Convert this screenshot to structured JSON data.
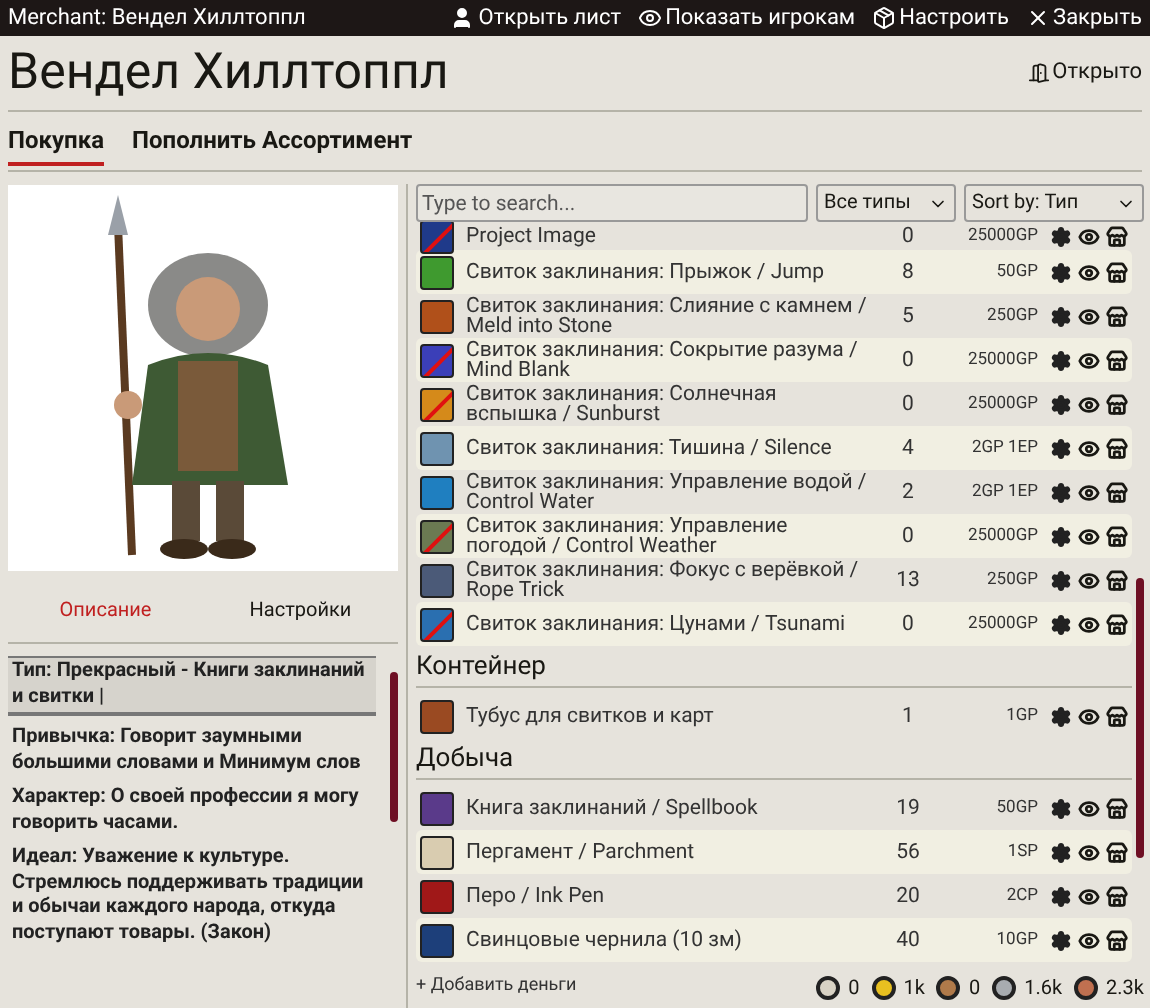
{
  "window": {
    "title": "Merchant: Вендел Хиллтоппл",
    "actions": [
      {
        "kind": "user",
        "label": "Открыть лист"
      },
      {
        "kind": "eye",
        "label": "Показать игрокам"
      },
      {
        "kind": "box",
        "label": "Настроить"
      },
      {
        "kind": "close",
        "label": "Закрыть"
      }
    ]
  },
  "merchant": {
    "name": "Вендел Хиллтоппл",
    "status": "Открыто"
  },
  "tabs": [
    {
      "label": "Покупка",
      "selected": true
    },
    {
      "label": "Пополнить Ассортимент",
      "selected": false
    }
  ],
  "side_tabs": [
    {
      "label": "Описание",
      "selected": true
    },
    {
      "label": "Настройки",
      "selected": false
    }
  ],
  "description": [
    {
      "text": "Тип: Прекрасный - Книги заклинаний и свитки |",
      "boxed": true
    },
    {
      "text": "Привычка: Говорит заумными большими словами и Минимум слов",
      "boxed": false
    },
    {
      "text": "Характер: О своей профессии я могу говорить часами.",
      "boxed": false
    },
    {
      "text": "Идеал: Уважение к культуре. Стремлюсь поддерживать традиции и обычаи каждого народа, откуда поступают товары. (Закон)",
      "boxed": false
    }
  ],
  "search": {
    "placeholder": "Type to search..."
  },
  "type_filter": "Все типы",
  "sort": "Sort by: Тип",
  "sections": [
    {
      "items": [
        {
          "name": "Project Image",
          "qty": "0",
          "price": "25000GP",
          "color": "#1f3a8a",
          "crossed": true,
          "cut": true
        },
        {
          "name": "Свиток заклинания: Прыжок / Jump",
          "qty": "8",
          "price": "50GP",
          "color": "#3f9a2f",
          "crossed": false
        },
        {
          "name": "Свиток заклинания: Слияние с камнем / Meld into Stone",
          "qty": "5",
          "price": "250GP",
          "color": "#b0501a",
          "crossed": false
        },
        {
          "name": "Свиток заклинания: Сокрытие разума / Mind Blank",
          "qty": "0",
          "price": "25000GP",
          "color": "#3b3fb8",
          "crossed": true
        },
        {
          "name": "Свиток заклинания: Солнечная вспышка / Sunburst",
          "qty": "0",
          "price": "25000GP",
          "color": "#d58a1a",
          "crossed": true
        },
        {
          "name": "Свиток заклинания: Тишина / Silence",
          "qty": "4",
          "price": "2GP 1EP",
          "color": "#6f93b0",
          "crossed": false
        },
        {
          "name": "Свиток заклинания: Управление водой / Control Water",
          "qty": "2",
          "price": "2GP 1EP",
          "color": "#1f7fc0",
          "crossed": false
        },
        {
          "name": "Свиток заклинания: Управление погодой / Control Weather",
          "qty": "0",
          "price": "25000GP",
          "color": "#6b7a52",
          "crossed": true
        },
        {
          "name": "Свиток заклинания: Фокус с верёвкой / Rope Trick",
          "qty": "13",
          "price": "250GP",
          "color": "#4b5a78",
          "crossed": false
        },
        {
          "name": "Свиток заклинания: Цунами / Tsunami",
          "qty": "0",
          "price": "25000GP",
          "color": "#2a6fb0",
          "crossed": true
        }
      ]
    },
    {
      "title": "Контейнер",
      "items": [
        {
          "name": "Тубус для свитков и карт",
          "qty": "1",
          "price": "1GP",
          "color": "#9a4a22",
          "crossed": false
        }
      ]
    },
    {
      "title": "Добыча",
      "items": [
        {
          "name": "Книга заклинаний / Spellbook",
          "qty": "19",
          "price": "50GP",
          "color": "#5a3a8a",
          "crossed": false
        },
        {
          "name": "Пергамент / Parchment",
          "qty": "56",
          "price": "1SP",
          "color": "#d9ccb0",
          "crossed": false
        },
        {
          "name": "Перо / Ink Pen",
          "qty": "20",
          "price": "2CP",
          "color": "#a01818",
          "crossed": false
        },
        {
          "name": "Свинцовые чернила (10 зм)",
          "qty": "40",
          "price": "10GP",
          "color": "#1d3f7a",
          "crossed": false
        }
      ]
    }
  ],
  "add_money": "+ Добавить деньги",
  "coins": [
    {
      "value": "0",
      "color": "#d8d2c4"
    },
    {
      "value": "1k",
      "color": "#e8c020"
    },
    {
      "value": "0",
      "color": "#b07a4a"
    },
    {
      "value": "1.6k",
      "color": "#a8acb0"
    },
    {
      "value": "2.3k",
      "color": "#c07050"
    }
  ]
}
